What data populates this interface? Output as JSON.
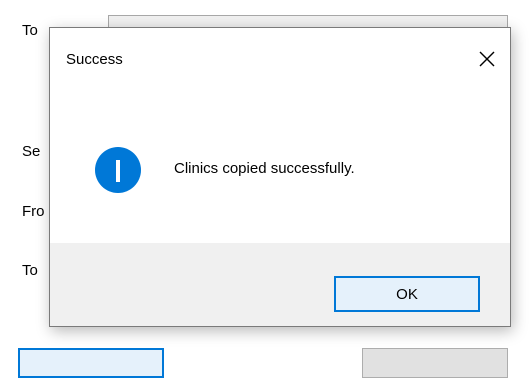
{
  "background": {
    "labels": [
      "To",
      "Se",
      "Fro",
      "To"
    ]
  },
  "dialog": {
    "title": "Success",
    "close_icon": "close-icon",
    "info_icon": "information-icon",
    "message": "Clinics copied successfully.",
    "ok_label": "OK"
  },
  "colors": {
    "accent": "#0078d7",
    "footer_bg": "#f0f0f0",
    "button_bg": "#e5f1fb"
  }
}
